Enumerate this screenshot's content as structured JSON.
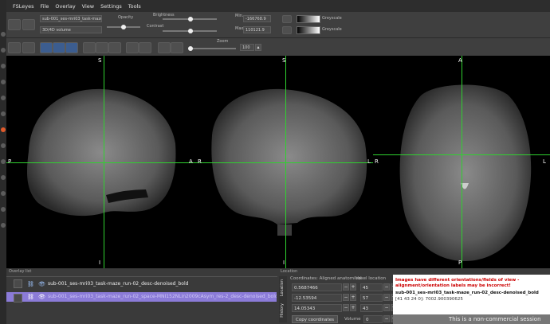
{
  "menubar": {
    "items": [
      "FSLeyes",
      "File",
      "Overlay",
      "View",
      "Settings",
      "Tools"
    ]
  },
  "toolbar1": {
    "overlay_name": "sub-001_ses-mri03_task-maze",
    "volume_label": "3D/4D volume",
    "opacity_label": "Opacity",
    "brightness_label": "Brightness",
    "contrast_label": "Contrast",
    "min_label": "Min.",
    "max_label": "Max.",
    "min_value": "-166768.9",
    "max_value": "110121.9",
    "cmap1": "Greyscale",
    "cmap2": "Greyscale"
  },
  "toolbar2": {
    "zoom_label": "Zoom",
    "zoom_value": "100"
  },
  "viewer": {
    "sag": {
      "top": "S",
      "bottom": "I",
      "left": "P",
      "right": "A"
    },
    "cor": {
      "top": "S",
      "bottom": "I",
      "left": "R",
      "right": "L"
    },
    "axi": {
      "top": "A",
      "bottom": "P",
      "left": "R",
      "right": "L"
    }
  },
  "overlay_list": {
    "title": "Overlay list",
    "items": [
      "sub-001_ses-mri03_task-maze_run-02_desc-denoised_bold",
      "sub-001_ses-mri03_task-maze_run-02_space-MNI152NLin2009cAsym_res-2_desc-denoised_bold"
    ]
  },
  "location": {
    "title": "Location",
    "tabs": [
      "History",
      "Location"
    ],
    "coords_header": "Coordinates: Aligned anatomical",
    "voxel_header": "Voxel location",
    "coords": [
      "0.5687466",
      "-12.53594",
      "14.05343"
    ],
    "voxels": [
      "45",
      "57",
      "43"
    ],
    "copy_button": "Copy coordinates",
    "volume_label": "Volume",
    "volume_value": "0"
  },
  "warning": {
    "line1": "Images have different orientations/fields of view -",
    "line2": "alignment/orientation labels may be incorrect!",
    "name": "sub-001_ses-mri03_task-maze_run-02_desc-denoised_bold",
    "values": "[41 43 24 0]: 7002.900390625",
    "footer": "This is a non-commercial session"
  },
  "colors": {
    "cursor": "#2fd12f",
    "selected_row": "#8b7bd8",
    "warning_red": "#cc0000"
  }
}
